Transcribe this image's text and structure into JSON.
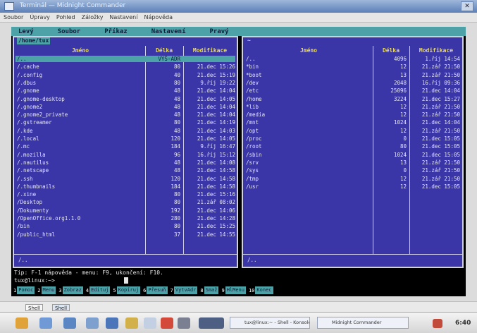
{
  "window": {
    "title": "Terminál — Midnight Commander"
  },
  "menubar": [
    "Soubor",
    "Úpravy",
    "Pohled",
    "Záložky",
    "Nastavení",
    "Nápověda"
  ],
  "mc_menu": [
    "Levý",
    "Soubor",
    "Příkaz",
    "Nastavení",
    "Pravý"
  ],
  "left_panel": {
    "path": "/home/tux",
    "col_name": "Jméno",
    "col_size": "Délka",
    "col_modified": "Modifikace",
    "rows": [
      {
        "name": "/..",
        "size": "VYŠ-ADR",
        "date": ""
      },
      {
        "name": "/.cache",
        "size": "80",
        "date": "21.dec 15:26"
      },
      {
        "name": "/.config",
        "size": "40",
        "date": "21.dec 15:19"
      },
      {
        "name": "/.dbus",
        "size": "80",
        "date": "9.říj 19:22"
      },
      {
        "name": "/.gnome",
        "size": "48",
        "date": "21.dec 14:04"
      },
      {
        "name": "/.gnome-desktop",
        "size": "48",
        "date": "21.dec 14:05"
      },
      {
        "name": "/.gnome2",
        "size": "48",
        "date": "21.dec 14:04"
      },
      {
        "name": "/.gnome2_private",
        "size": "48",
        "date": "21.dec 14:04"
      },
      {
        "name": "/.gstreamer",
        "size": "80",
        "date": "21.dec 14:19"
      },
      {
        "name": "/.kde",
        "size": "48",
        "date": "21.dec 14:03"
      },
      {
        "name": "/.local",
        "size": "120",
        "date": "21.dec 14:05"
      },
      {
        "name": "/.mc",
        "size": "184",
        "date": "9.říj 16:47"
      },
      {
        "name": "/.mozilla",
        "size": "96",
        "date": "16.říj 15:12"
      },
      {
        "name": "/.nautilus",
        "size": "48",
        "date": "21.dec 14:08"
      },
      {
        "name": "/.netscape",
        "size": "48",
        "date": "21.dec 14:58"
      },
      {
        "name": "/.ssh",
        "size": "120",
        "date": "21.dec 14:58"
      },
      {
        "name": "/.thumbnails",
        "size": "184",
        "date": "21.dec 14:58"
      },
      {
        "name": "/.xine",
        "size": "80",
        "date": "21.dec 15:16"
      },
      {
        "name": "/Desktop",
        "size": "80",
        "date": "21.zář 08:02"
      },
      {
        "name": "/Dokumenty",
        "size": "192",
        "date": "21.dec 14:06"
      },
      {
        "name": "/OpenOffice.org1.1.0",
        "size": "280",
        "date": "21.dec 14:28"
      },
      {
        "name": "/bin",
        "size": "80",
        "date": "21.dec 15:25"
      },
      {
        "name": "/public_html",
        "size": "37",
        "date": "21.dec 14:55"
      }
    ],
    "mini_status": "/.."
  },
  "right_panel": {
    "path": "~",
    "col_name": "Jméno",
    "col_size": "Délka",
    "col_modified": "Modifikace",
    "rows": [
      {
        "name": "/..",
        "size": "4096",
        "date": "1.říj 14:54"
      },
      {
        "name": "*bin",
        "size": "12",
        "date": "21.zář 21:50"
      },
      {
        "name": "*boot",
        "size": "13",
        "date": "21.zář 21:50"
      },
      {
        "name": "/dev",
        "size": "2048",
        "date": "16.říj 09:36"
      },
      {
        "name": "/etc",
        "size": "25096",
        "date": "21.dec 14:04"
      },
      {
        "name": "/home",
        "size": "3224",
        "date": "21.dec 15:27"
      },
      {
        "name": "*lib",
        "size": "12",
        "date": "21.zář 21:50"
      },
      {
        "name": "/media",
        "size": "12",
        "date": "21.zář 21:50"
      },
      {
        "name": "/mnt",
        "size": "1024",
        "date": "21.dec 14:04"
      },
      {
        "name": "/opt",
        "size": "12",
        "date": "21.zář 21:50"
      },
      {
        "name": "/proc",
        "size": "0",
        "date": "21.dec 15:05"
      },
      {
        "name": "/root",
        "size": "80",
        "date": "21.dec 15:05"
      },
      {
        "name": "/sbin",
        "size": "1024",
        "date": "21.dec 15:05"
      },
      {
        "name": "/srv",
        "size": "13",
        "date": "21.zář 21:50"
      },
      {
        "name": "/sys",
        "size": "0",
        "date": "21.zář 21:50"
      },
      {
        "name": "/tmp",
        "size": "12",
        "date": "21.zář 21:50"
      },
      {
        "name": "/usr",
        "size": "12",
        "date": "21.dec 15:05"
      }
    ],
    "mini_status": "/.."
  },
  "hint_line": "Tip: F-1 nápověda - menu: F9, ukončení: F10.",
  "prompt": "tux@linux:~>",
  "fkeys": [
    {
      "num": "1",
      "label": "Pomoc"
    },
    {
      "num": "2",
      "label": "Menu"
    },
    {
      "num": "3",
      "label": "Zobraz"
    },
    {
      "num": "4",
      "label": "Edituj"
    },
    {
      "num": "5",
      "label": "Kopíruj"
    },
    {
      "num": "6",
      "label": "Přesuň"
    },
    {
      "num": "7",
      "label": "VytvAdr"
    },
    {
      "num": "8",
      "label": "Smaž"
    },
    {
      "num": "9",
      "label": "HlMenu"
    },
    {
      "num": "10",
      "label": "Konec"
    }
  ],
  "tabbar": {
    "tab1": "Shell",
    "tab2": "Shell"
  },
  "taskbar": {
    "win1": "tux@linux:~ - Shell - Konsole",
    "win2": "Midnight Commander",
    "clock": "6:40"
  }
}
